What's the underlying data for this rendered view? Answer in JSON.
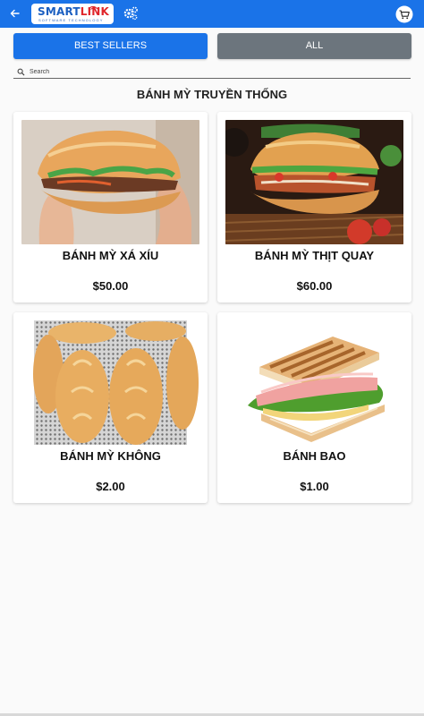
{
  "header": {
    "logo_text_a": "SMART",
    "logo_text_b": "LINK",
    "logo_tagline": "SOFTWARE TECHNOLOGY",
    "back_icon": "arrow-left-icon",
    "settings_icon": "gears-icon",
    "cart_icon": "cart-icon",
    "bar_color": "#1a73e8"
  },
  "tabs": [
    {
      "label": "BEST SELLERS",
      "color": "#1a73e8",
      "active": true
    },
    {
      "label": "ALL",
      "color": "#6c757d",
      "active": false
    }
  ],
  "search": {
    "placeholder": "Search",
    "icon": "search-icon"
  },
  "section": {
    "title": "BÁNH MỲ TRUYỀN THỐNG"
  },
  "products": [
    {
      "name": "BÁNH MỲ XÁ XÍU",
      "price": "$50.00"
    },
    {
      "name": "BÁNH MỲ THỊT QUAY",
      "price": "$60.00"
    },
    {
      "name": "BÁNH MỲ KHÔNG",
      "price": "$2.00"
    },
    {
      "name": "BÁNH BAO",
      "price": "$1.00"
    }
  ]
}
